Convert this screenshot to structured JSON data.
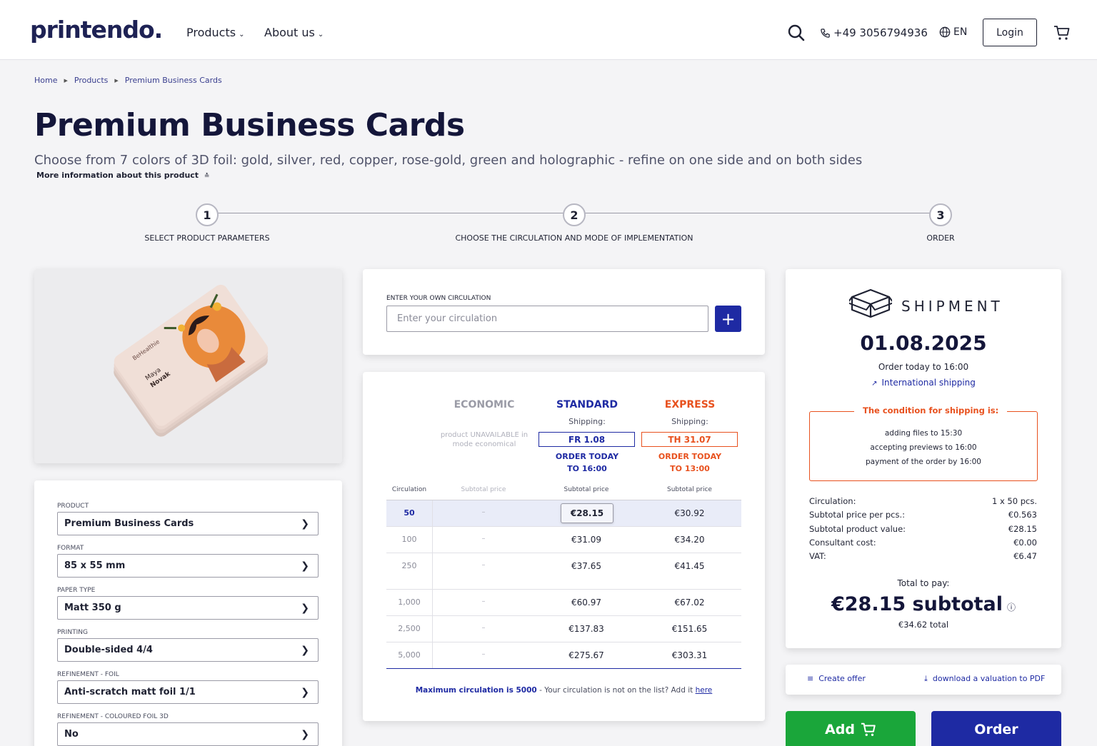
{
  "header": {
    "logo": "printendo.",
    "nav": [
      {
        "label": "Products"
      },
      {
        "label": "About us"
      }
    ],
    "phone": "+49 3056794936",
    "language": "EN",
    "login_label": "Login"
  },
  "breadcrumb": [
    "Home",
    "Products",
    "Premium Business Cards"
  ],
  "page": {
    "title": "Premium Business Cards",
    "subtitle": "Choose from 7 colors of 3D foil: gold, silver, red, copper, rose-gold, green and holographic - refine on one side and on both sides",
    "more_info": "More information about this product"
  },
  "steps": [
    {
      "number": "1",
      "label": "SELECT PRODUCT PARAMETERS"
    },
    {
      "number": "2",
      "label": "CHOOSE THE CIRCULATION AND MODE OF IMPLEMENTATION"
    },
    {
      "number": "3",
      "label": "ORDER"
    }
  ],
  "product_image": {
    "card_text": [
      "BeHealthie",
      "Maya",
      "Novak"
    ]
  },
  "params": [
    {
      "label": "PRODUCT",
      "value": "Premium Business Cards"
    },
    {
      "label": "FORMAT",
      "value": "85 x 55 mm"
    },
    {
      "label": "PAPER TYPE",
      "value": "Matt 350 g"
    },
    {
      "label": "PRINTING",
      "value": "Double-sided 4/4"
    },
    {
      "label": "REFINEMENT - FOIL",
      "value": "Anti-scratch matt foil 1/1"
    },
    {
      "label": "REFINEMENT - COLOURED FOIL 3D",
      "value": "No"
    }
  ],
  "circulation": {
    "label": "ENTER YOUR OWN CIRCULATION",
    "placeholder": "Enter your circulation",
    "add_icon": "plus-icon"
  },
  "modes": {
    "economic": {
      "title": "ECONOMIC",
      "note": "product UNAVAILABLE in mode economical"
    },
    "standard": {
      "title": "STANDARD",
      "shipping_label": "Shipping:",
      "shipping_date": "FR 1.08",
      "order_today": "ORDER TODAY TO 16:00"
    },
    "express": {
      "title": "EXPRESS",
      "shipping_label": "Shipping:",
      "shipping_date": "TH 31.07",
      "order_today": "ORDER TODAY TO 13:00"
    }
  },
  "table": {
    "headers": [
      "Circulation",
      "Subtotal price",
      "Subtotal price",
      "Subtotal price"
    ],
    "rows": [
      {
        "circulation": "50",
        "economic": "–",
        "standard": "€28.15",
        "express": "€30.92"
      },
      {
        "circulation": "100",
        "economic": "–",
        "standard": "€31.09",
        "express": "€34.20"
      },
      {
        "circulation": "250",
        "economic": "–",
        "standard": "€37.65",
        "express": "€41.45"
      },
      {
        "circulation": "1,000",
        "economic": "–",
        "standard": "€60.97",
        "express": "€67.02"
      },
      {
        "circulation": "2,500",
        "economic": "–",
        "standard": "€137.83",
        "express": "€151.65"
      },
      {
        "circulation": "5,000",
        "economic": "–",
        "standard": "€275.67",
        "express": "€303.31"
      }
    ],
    "footer_bold": "Maximum circulation is 5000",
    "footer_text": " - Your circulation is not on the list? Add it ",
    "footer_link": "here"
  },
  "shipment": {
    "title": "SHIPMENT",
    "date": "01.08.2025",
    "order_today": "Order today to 16:00",
    "international": "International shipping",
    "condition_title": "The condition for shipping is:",
    "conditions": [
      "adding files to 15:30",
      "accepting previews to 16:00",
      "payment of the order by 16:00"
    ],
    "summary": [
      {
        "key": "Circulation:",
        "value": "1 x 50 pcs."
      },
      {
        "key": "Subtotal price per pcs.:",
        "value": "€0.563"
      },
      {
        "key": "Subtotal product value:",
        "value": "€28.15"
      },
      {
        "key": "Consultant cost:",
        "value": "€0.00"
      },
      {
        "key": "VAT:",
        "value": "€6.47"
      }
    ],
    "total_label": "Total to pay:",
    "total_subtotal": "€28.15 subtotal",
    "total": "€34.62 total"
  },
  "actions": {
    "create_offer": "Create offer",
    "download_pdf": "download a valuation to PDF",
    "add": "Add",
    "order": "Order"
  },
  "colors": {
    "brand_dark": "#1e2254",
    "blue": "#1e2aa3",
    "express": "#e8511e",
    "green": "#1aa63a"
  }
}
